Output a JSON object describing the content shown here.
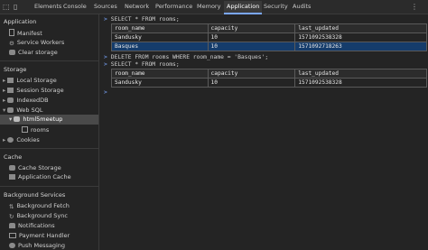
{
  "tabs": [
    "Elements",
    "Console",
    "Sources",
    "Network",
    "Performance",
    "Memory",
    "Application",
    "Security",
    "Audits"
  ],
  "active_tab": "Application",
  "sidebar": {
    "application_header": "Application",
    "manifest": "Manifest",
    "service_workers": "Service Workers",
    "clear_storage": "Clear storage",
    "storage_header": "Storage",
    "local_storage": "Local Storage",
    "session_storage": "Session Storage",
    "indexeddb": "IndexedDB",
    "web_sql": "Web SQL",
    "db_name": "html5meetup",
    "table_name": "rooms",
    "cookies": "Cookies",
    "cache_header": "Cache",
    "cache_storage": "Cache Storage",
    "application_cache": "Application Cache",
    "bg_header": "Background Services",
    "background_fetch": "Background Fetch",
    "background_sync": "Background Sync",
    "notifications": "Notifications",
    "payment_handler": "Payment Handler",
    "push_messaging": "Push Messaging"
  },
  "console": {
    "prompt": ">",
    "q1": "SELECT * FROM rooms;",
    "q2": "DELETE FROM rooms WHERE room_name = 'Basques';",
    "q3": "SELECT * FROM rooms;",
    "columns": [
      "room_name",
      "capacity",
      "last_updated"
    ],
    "result1": [
      [
        "Sandusky",
        "10",
        "1571092538328"
      ],
      [
        "Basques",
        "10",
        "1571092718263"
      ]
    ],
    "result2": [
      [
        "Sandusky",
        "10",
        "1571092538328"
      ]
    ]
  }
}
